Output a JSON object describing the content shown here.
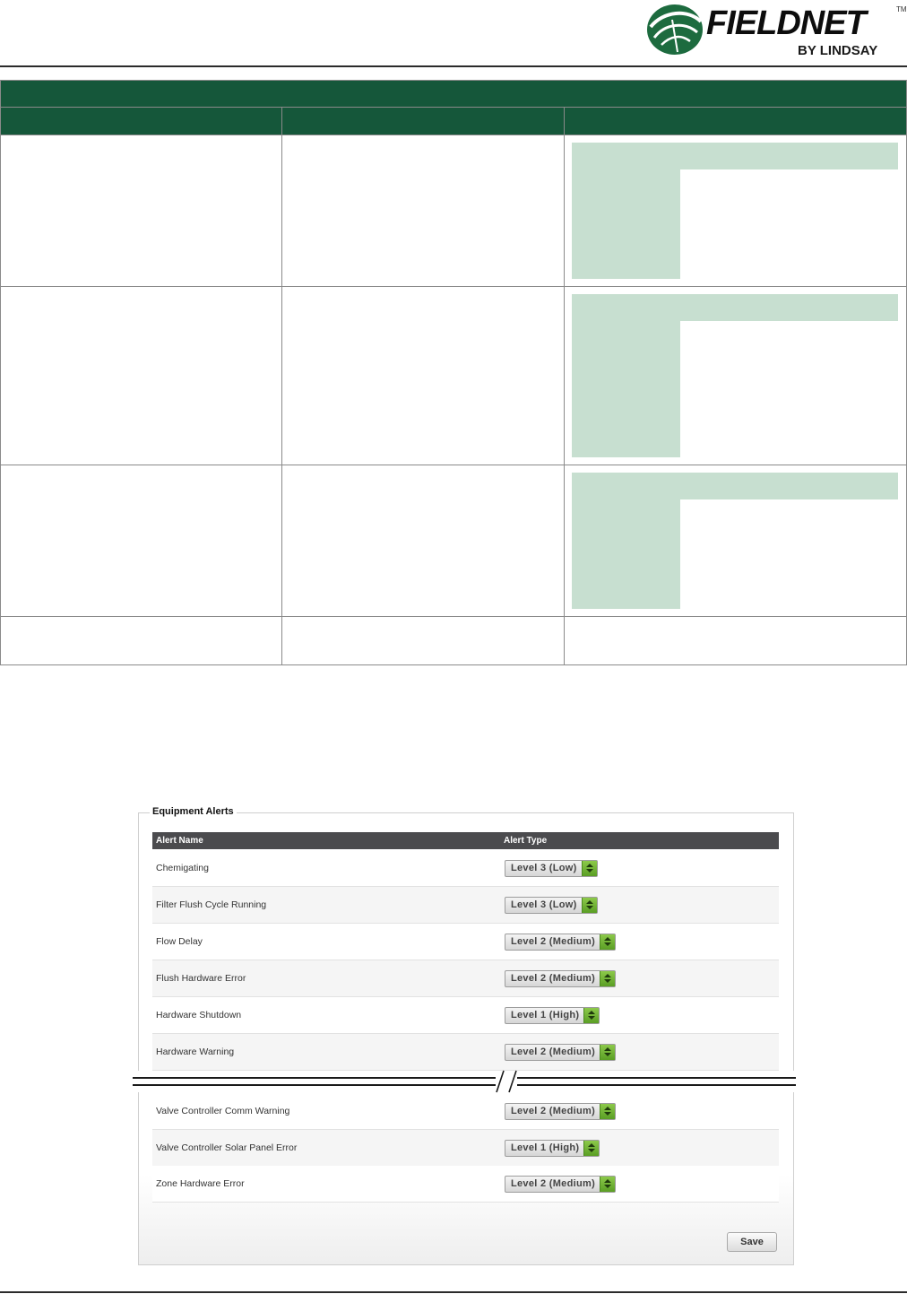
{
  "header": {
    "brand": "FIELDNET",
    "trademark": "TM",
    "sub": "BY LINDSAY"
  },
  "equipment_alerts": {
    "title": "Equipment Alerts",
    "columns": [
      "Alert Name",
      "Alert Type"
    ],
    "rows": [
      {
        "name": "Chemigating",
        "level": "Level 3 (Low)"
      },
      {
        "name": "Filter Flush Cycle Running",
        "level": "Level 3 (Low)"
      },
      {
        "name": "Flow Delay",
        "level": "Level 2 (Medium)"
      },
      {
        "name": "Flush Hardware Error",
        "level": "Level 2 (Medium)"
      },
      {
        "name": "Hardware Shutdown",
        "level": "Level 1 (High)"
      },
      {
        "name": "Hardware Warning",
        "level": "Level 2 (Medium)"
      },
      {
        "name": "Valve Controller Comm Warning",
        "level": "Level 2 (Medium)"
      },
      {
        "name": "Valve Controller Solar Panel Error",
        "level": "Level 1 (High)"
      },
      {
        "name": "Zone Hardware Error",
        "level": "Level 2 (Medium)"
      }
    ],
    "save_label": "Save"
  },
  "colors": {
    "brand_green": "#15573a",
    "shade_green": "#c7dfd0",
    "table_header": "#4b4b4e",
    "select_arrow_green": "#6fb236"
  }
}
